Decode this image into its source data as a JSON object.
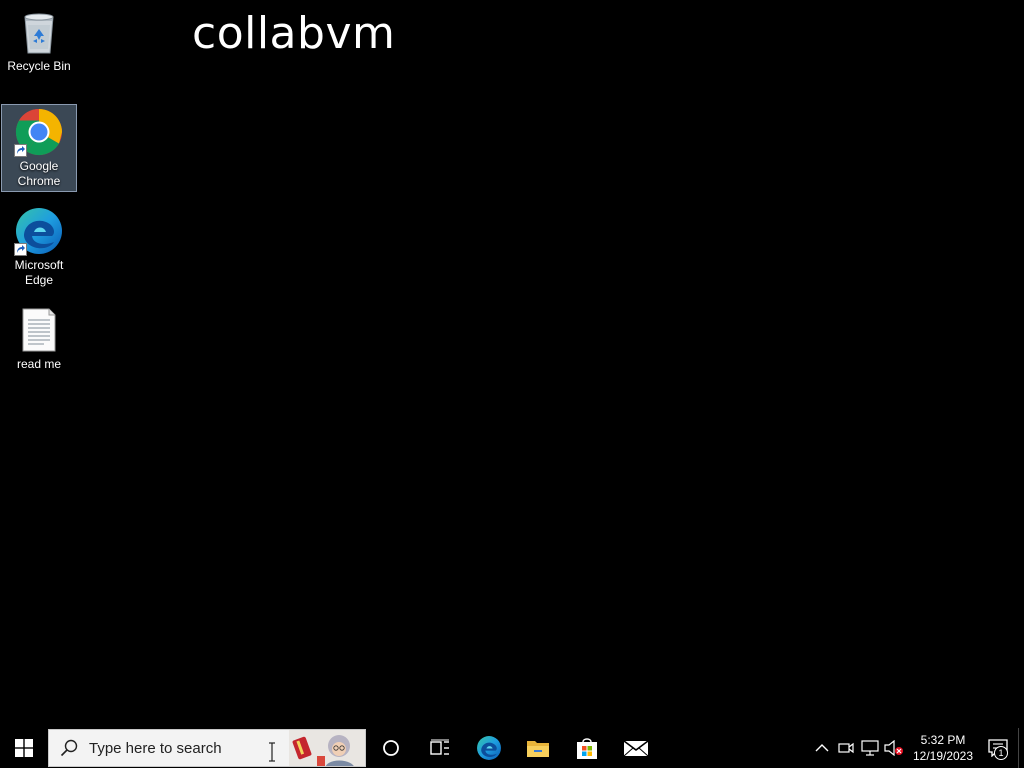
{
  "watermark": {
    "text": "collabvm"
  },
  "desktop_icons": [
    {
      "label": "Recycle Bin",
      "icon": "recycle-bin-icon",
      "selected": false
    },
    {
      "label": "Google Chrome",
      "icon": "chrome-icon",
      "selected": true,
      "shortcut": true
    },
    {
      "label": "Microsoft Edge",
      "icon": "edge-icon",
      "selected": false,
      "shortcut": true
    },
    {
      "label": "read me",
      "icon": "text-document-icon",
      "selected": false
    }
  ],
  "taskbar": {
    "search_placeholder": "Type here to search",
    "pinned": [
      {
        "name": "cortana",
        "icon": "cortana-circle-icon"
      },
      {
        "name": "task-view",
        "icon": "task-view-icon"
      },
      {
        "name": "microsoft-edge",
        "icon": "edge-icon"
      },
      {
        "name": "file-explorer",
        "icon": "folder-icon"
      },
      {
        "name": "microsoft-store",
        "icon": "store-bag-icon"
      },
      {
        "name": "mail",
        "icon": "mail-envelope-icon"
      }
    ],
    "tray": {
      "time": "5:32 PM",
      "date": "12/19/2023",
      "notification_count": "1"
    }
  },
  "colors": {
    "desktop_bg": "#000000",
    "taskbar_bg": "#000000",
    "search_bg": "#f3f3f3",
    "selection": "#5a6e82"
  }
}
